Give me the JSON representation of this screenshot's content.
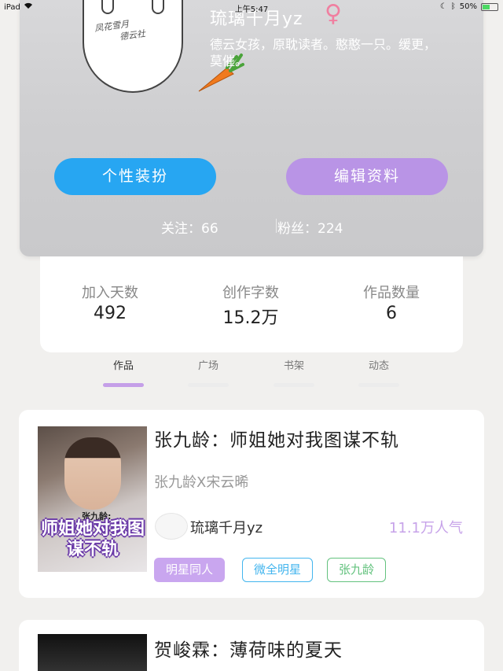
{
  "status_bar": {
    "device": "iPad",
    "time": "上午5:47",
    "battery_percent": "50%",
    "battery_level": 0.5
  },
  "profile": {
    "avatar_text_line1": "凤花雪月",
    "avatar_text_line2": "德云社",
    "name": "琉璃千月yz",
    "gender_symbol": "♀",
    "bio": "德云女孩，原耽读者。憨憨一只。缓更，莫催。",
    "buttons": {
      "dress_up": "个性装扮",
      "edit_profile": "编辑资料"
    },
    "following": "关注：66",
    "followers": "粉丝：224"
  },
  "stats": [
    {
      "label": "加入天数",
      "value": "492"
    },
    {
      "label": "创作字数",
      "value": "15.2万"
    },
    {
      "label": "作品数量",
      "value": "6"
    }
  ],
  "tabs": [
    {
      "label": "作品",
      "active": true
    },
    {
      "label": "广场",
      "active": false
    },
    {
      "label": "书架",
      "active": false
    },
    {
      "label": "动态",
      "active": false
    }
  ],
  "works": [
    {
      "title": "张九龄：师姐她对我图谋不轨",
      "cp": "张九龄X宋云晞",
      "author": "琉璃千月yz",
      "popularity": "11.1万人气",
      "cover_subtitle": "张九龄:",
      "cover_title": "师姐她对我图谋不轨",
      "tags": [
        "明星同人",
        "微全明星",
        "张九龄"
      ]
    },
    {
      "title": "贺峻霖：薄荷味的夏天"
    }
  ],
  "colors": {
    "accent_blue": "#27a6f2",
    "accent_purple": "#b994e6",
    "tab_active": "#c59fe8",
    "gender_pink": "#f07fa0"
  }
}
